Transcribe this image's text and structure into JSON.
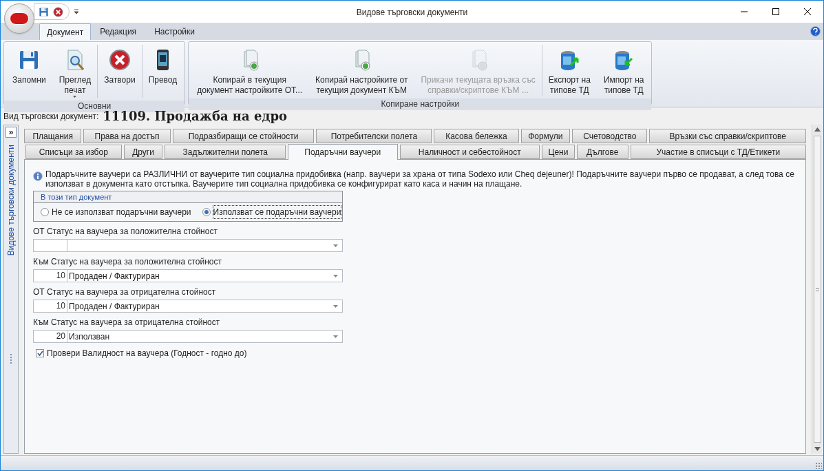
{
  "window": {
    "title": "Видове търговски документи"
  },
  "quick_access": [
    {
      "kind": "save"
    },
    {
      "kind": "close"
    }
  ],
  "ribbon": {
    "tabs": [
      {
        "label": "Документ",
        "selected": true
      },
      {
        "label": "Редакция",
        "selected": false
      },
      {
        "label": "Настройки",
        "selected": false
      }
    ],
    "groups": [
      {
        "label": "Основни",
        "buttons": [
          {
            "label": "Запомни",
            "kind": "save",
            "disabled": false,
            "dropdown": false,
            "separator_before": false
          },
          {
            "label": "Преглед\nпечат",
            "kind": "preview",
            "disabled": false,
            "dropdown": true,
            "separator_before": false
          },
          {
            "label": "Затвори",
            "kind": "close",
            "disabled": false,
            "dropdown": false,
            "separator_before": true
          },
          {
            "label": "Превод",
            "kind": "phone",
            "disabled": false,
            "dropdown": false,
            "separator_before": true
          }
        ]
      },
      {
        "label": "Копиране настройки",
        "buttons": [
          {
            "label": "Копирай в текущия\nдокумент настройките ОТ...",
            "kind": "copy-in",
            "disabled": false,
            "dropdown": false,
            "separator_before": false
          },
          {
            "label": "Копирай настройките от\nтекущия документ КЪМ",
            "kind": "copy-out",
            "disabled": false,
            "dropdown": false,
            "separator_before": false
          },
          {
            "label": "Прикачи текущата връзка със\nсправки/скриптове КЪМ ...",
            "kind": "attach",
            "disabled": true,
            "dropdown": false,
            "separator_before": false
          },
          {
            "label": "Експорт на\nтипове ТД",
            "kind": "export",
            "disabled": false,
            "dropdown": false,
            "separator_before": true
          },
          {
            "label": "Импорт на\nтипове ТД",
            "kind": "import",
            "disabled": false,
            "dropdown": false,
            "separator_before": false
          }
        ]
      }
    ]
  },
  "doc_type": {
    "label": "Вид търговски документ:",
    "value": "11109. Продажба на едро"
  },
  "side_panel": {
    "toggle": "»",
    "title": "Видове търговски документи"
  },
  "tab_rows": [
    [
      {
        "label": "Плащания",
        "selected": false
      },
      {
        "label": "Права на достъп",
        "selected": false
      },
      {
        "label": "Подразбиращи се стойности",
        "selected": false
      },
      {
        "label": "Потребителски полета",
        "selected": false
      },
      {
        "label": "Касова бележка",
        "selected": false
      },
      {
        "label": "Формули",
        "selected": false
      },
      {
        "label": "Счетоводство",
        "selected": false
      },
      {
        "label": "Връзки със справки/скриптове",
        "selected": false
      }
    ],
    [
      {
        "label": "Списъци за избор",
        "selected": false
      },
      {
        "label": "Други",
        "selected": false
      },
      {
        "label": "Задължителни полета",
        "selected": false
      },
      {
        "label": "Подаръчни ваучери",
        "selected": true
      },
      {
        "label": "Наличност и себестойност",
        "selected": false
      },
      {
        "label": "Цени",
        "selected": false
      },
      {
        "label": "Дългове",
        "selected": false
      },
      {
        "label": "Участие в списъци с ТД/Етикети",
        "selected": false
      }
    ]
  ],
  "info": "Подаръчните ваучери са РАЗЛИЧНИ от ваучерите тип социална придобивка (напр. ваучери за храна от типа Sodexo или Cheq dejeuner)! Подаръчните ваучери първо се продават, а след това се използват в документа като отстъпка. Ваучерите тип социална придобивка се конфигурират като каса и начин на плащане.",
  "usage_group": {
    "title": "В този тип документ",
    "options": [
      {
        "label": "Не се използват подаръчни ваучери",
        "selected": false
      },
      {
        "label": "Използват се подаръчни ваучери",
        "selected": true
      }
    ]
  },
  "status_fields": [
    {
      "label": "ОТ Статус на ваучера за положителна стойност"
    },
    {
      "label": "Към Статус на ваучера за положителна стойност",
      "code": "10",
      "value": "Продаден / Фактуриран"
    },
    {
      "label": "ОТ Статус на ваучера за отрицателна стойност",
      "code": "10",
      "value": "Продаден / Фактуриран"
    },
    {
      "label": "Към Статус на ваучера за отрицателна стойност",
      "code": "20",
      "value": "Използван"
    }
  ],
  "validity_check": {
    "label": "Провери Валидност на ваучера (Годност - годно до)",
    "checked": true
  }
}
